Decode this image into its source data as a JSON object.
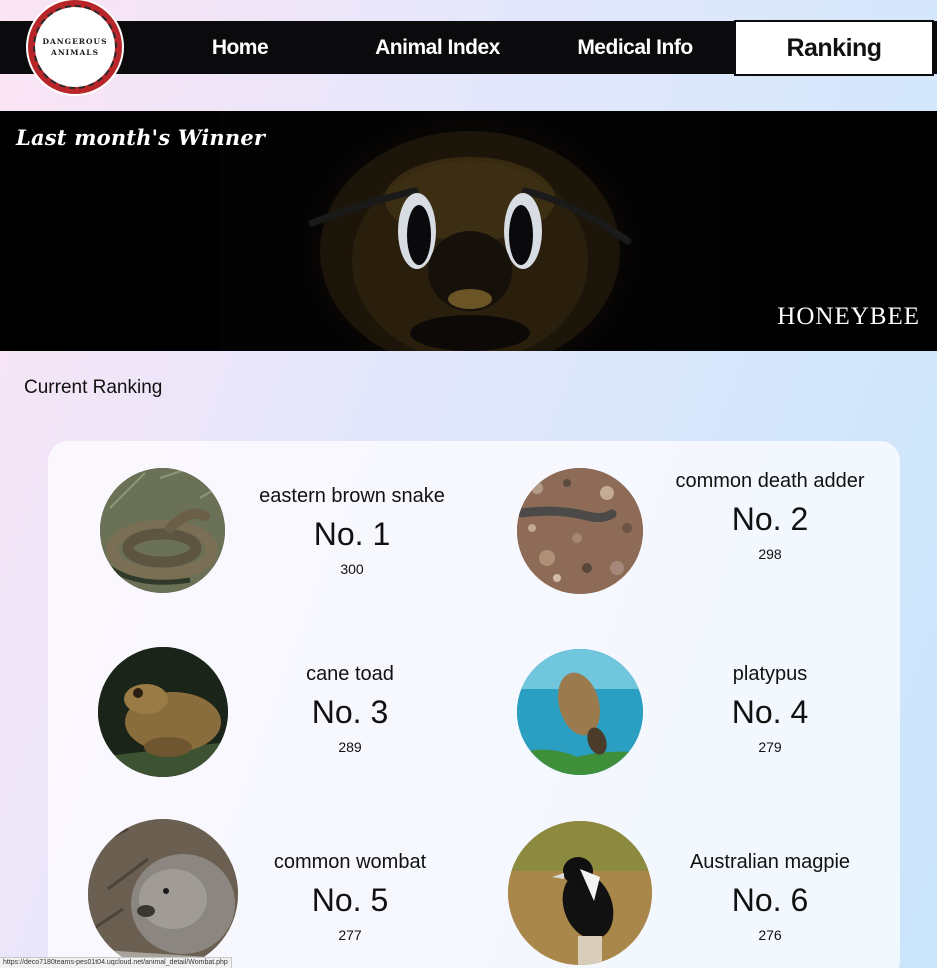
{
  "header": {
    "logo_line1": "DANGEROUS",
    "logo_line2": "ANIMALS",
    "nav": [
      {
        "label": "Home"
      },
      {
        "label": "Animal Index"
      },
      {
        "label": "Medical Info"
      },
      {
        "label": "Ranking",
        "active": true
      }
    ]
  },
  "hero": {
    "title": "Last month's Winner",
    "animal": "HONEYBEE"
  },
  "ranking": {
    "section_title": "Current Ranking",
    "items": [
      {
        "name": "eastern brown snake",
        "rank": "No. 1",
        "votes": "300"
      },
      {
        "name": "common death adder",
        "rank": "No. 2",
        "votes": "298"
      },
      {
        "name": "cane toad",
        "rank": "No. 3",
        "votes": "289"
      },
      {
        "name": "platypus",
        "rank": "No. 4",
        "votes": "279"
      },
      {
        "name": "common wombat",
        "rank": "No. 5",
        "votes": "277"
      },
      {
        "name": "Australian magpie",
        "rank": "No. 6",
        "votes": "276"
      }
    ]
  },
  "status_bar": {
    "url": "https://deco7180teams-pes01t04.uqcloud.net/animal_detail/Wombat.php"
  },
  "colors": {
    "nav_background": "#0b0b0d",
    "logo_ring": "#b8262a",
    "hero_background": "#000000"
  }
}
